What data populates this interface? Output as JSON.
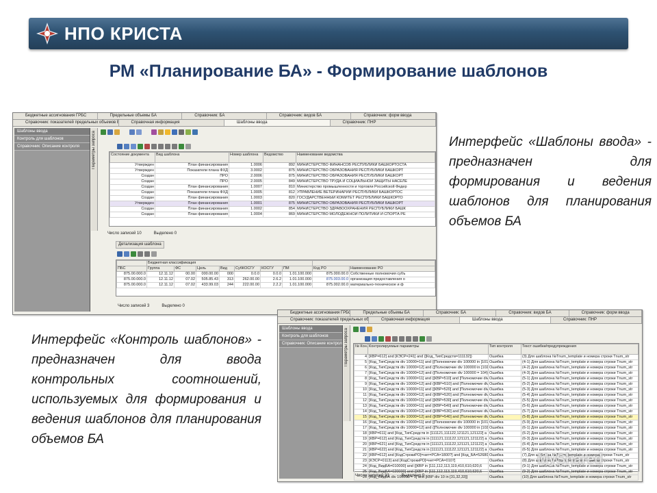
{
  "header": {
    "logo_text": "НПО КРИСТА"
  },
  "title": "РМ «Планирование БА» - Формирование шаблонов",
  "descriptions": [
    "Интерфейс «Шаблоны ввода» - предназначен для формирования и ведения шаблонов для планирования объемов БА",
    "Интерфейс «Контроль шаблонов» - предназначен для ввода контрольных соотношений, используемых для формирования и ведения шаблонов для планирования объемов БА"
  ],
  "window1": {
    "tabs_row1": [
      "Бюджетные ассигнования ГРБС",
      "Предельные объемы БА",
      "Справочник: БА",
      "Справочник: видов БА",
      "Справочник: форм ввода"
    ],
    "tabs_row2": [
      "Справочник: показателей предельных объемов БА",
      "Справочная информация",
      "Шаблоны ввода",
      "Справочник: ПНР"
    ],
    "sidebar": [
      "Шаблоны ввода",
      "Контроль для шаблонов",
      "Справочник: Описание контроля"
    ],
    "vertical_tab": "Параметры запроса",
    "columns": [
      "Состояние документа",
      "Вид шаблона",
      "Номер шаблона",
      "Ведомство",
      "Наименование ведомства"
    ],
    "rows": [
      [
        "Утвержден",
        "План финансирования",
        "1.0006",
        "892",
        "МИНИСТЕРСТВО ФИНАНСОВ РЕСПУБЛИКИ БАШКОРТОСТА"
      ],
      [
        "Утвержден",
        "Показатели плана ФХД",
        "3.0002",
        "875",
        "МИНИСТЕРСТВО ОБРАЗОВАНИЯ РЕСПУБЛИКИ БАШКОРТ"
      ],
      [
        "Создан",
        "ПРО",
        "2.0006",
        "875",
        "МИНИСТЕРСТВО ОБРАЗОВАНИЯ РЕСПУБЛИКИ БАШКОРТ"
      ],
      [
        "Создан",
        "ПРО",
        "2.0005",
        "849",
        "МИНИСТЕРСТВО ТРУДА И СОЦИАЛЬНОЙ ЗАЩИТЫ НАСЕЛЕ"
      ],
      [
        "Создан",
        "План финансирования",
        "1.0007",
        "810",
        "Министерство промышленности и торговли Российской Федер"
      ],
      [
        "Создан",
        "Показатели плана ФХД",
        "1.0005",
        "812",
        "УПРАВЛЕНИЕ ВЕТЕРИНАРИИ РЕСПУБЛИКИ БАШКОРТОС"
      ],
      [
        "Создан",
        "План финансирования",
        "1.0003",
        "820",
        "ГОСУДАРСТВЕННЫЙ КОМИТЕТ РЕСПУБЛИКИ БАШКОРТО"
      ],
      [
        "Утвержден",
        "План финансирования",
        "1.0001",
        "875",
        "МИНИСТЕРСТВО ОБРАЗОВАНИЯ РЕСПУБЛИКИ БАШКОРТ"
      ],
      [
        "Создан",
        "План финансирования",
        "1.0002",
        "854",
        "МИНИСТЕРСТВО ЗДРАВООХРАНЕНИЯ РЕСПУБЛИКИ БАШК"
      ],
      [
        "Создан",
        "План финансирования",
        "1.0004",
        "869",
        "МИНИСТЕРСТВО МОЛОДЕЖНОЙ ПОЛИТИКИ И СПОРТА РЕ"
      ]
    ],
    "status1": {
      "label": "Число записей",
      "count": "10",
      "selected_label": "Выделено",
      "selected": "0"
    },
    "detail_title": "Детализация шаблона",
    "detail_columns": [
      "ПБС",
      "Группа",
      "ФС",
      "Цель",
      "Вид",
      "СубКОСГУ",
      "КОСГУ",
      "ПМ",
      "Код РО",
      "Наименование РО"
    ],
    "detail_group_header": "Бюджетная классификация",
    "detail_rows": [
      [
        "875.00.000.0",
        "12.11.12",
        "00.00",
        "000.00.00",
        "000",
        "0.0.0",
        "0.0.0",
        "1.01.100.000",
        "875.000.00.0",
        "Собственные полномочия субъ"
      ],
      [
        "875.00.000.0",
        "12.11.12",
        "07.02",
        "505.85.43",
        "313",
        "262.00.00",
        "2.6.2",
        "1.01.100.000",
        "875.003.00.0",
        "организация предоставления о"
      ],
      [
        "875.00.000.0",
        "12.11.12",
        "07.02",
        "433.99.03",
        "244",
        "222.00.00",
        "2.2.2",
        "1.01.100.000",
        "875.002.00.0",
        "материально-техническое и ф"
      ]
    ],
    "status2": {
      "label": "Число записей",
      "count": "3",
      "selected_label": "Выделено",
      "selected": "0"
    }
  },
  "window2": {
    "tabs_row1": [
      "Бюджетные ассигнования ГРБС",
      "Предельные объемы БА",
      "Справочник: БА",
      "Справочник: видов БА",
      "Справочник: форм ввода"
    ],
    "tabs_row2": [
      "Справочник: показателей предельных объемов БА",
      "Справочная информация",
      "Шаблоны ввода",
      "Справочник: ПНР"
    ],
    "sidebar": [
      "Шаблоны ввода",
      "Контроль для шаблонов",
      "Справочник: Описание контроля"
    ],
    "vertical_tab": "Параметры запроса",
    "columns": [
      "№ Кон...",
      "Контролируемые параметры",
      "Тип контроля",
      "Текст ошибки/предупреждения"
    ],
    "rows": [
      [
        "4",
        "[КВР=612] and [КЭСР=241] and ([Код_ТипСредств=111132])",
        "Ошибка",
        "(3) Для шаблона №Tnum_template и номера строки Tnum_str"
      ],
      [
        "5",
        "[Код_ТипСредств div 10000=11] and ([Полномочие div 100000 in [101.1",
        "Ошибка",
        "(4-1) Для шаблона №Tnum_template и номера строки Tnum_str"
      ],
      [
        "6",
        "[Код_ТипСредств div 10000=12] and ([Полномочие div 100000 in [102.1",
        "Ошибка",
        "(4-2) Для шаблона №Tnum_template и номера строки Tnum_str"
      ],
      [
        "7",
        "[Код_ТипСредств div 10000=12] and ([Полномочие div 100000 = 104)",
        "Ошибка",
        "(4-3) Для шаблона №Tnum_template и номера строки Tnum_str"
      ],
      [
        "8",
        "[Код_ТипСредств div 10000=11] and ([КВР=510] and [Полномочие div 1",
        "Ошибка",
        "(5-1) Для шаблона №Tnum_template и номера строки Tnum_str"
      ],
      [
        "9",
        "[Код_ТипСредств div 10000=12] and ([КВР=510] and [Полномочие div 1",
        "Ошибка",
        "(5-2) Для шаблона №Tnum_template и номера строки Tnum_str"
      ],
      [
        "10",
        "[Код_ТипСредств div 10000=11] and ([КВР=520] and [Полномочие div 1",
        "Ошибка",
        "(5-3) Для шаблона №Tnum_template и номера строки Tnum_str"
      ],
      [
        "11",
        "[Код_ТипСредств div 10000=12] and ([КВР=520] and [Полномочие div 1",
        "Ошибка",
        "(5-4) Для шаблона №Tnum_template и номера строки Tnum_str"
      ],
      [
        "12",
        "[Код_ТипСредств div 10000=11] and ([КВР=530] and [Полномочие div 1",
        "Ошибка",
        "(5-5) Для шаблона №Tnum_template и номера строки Tnum_str"
      ],
      [
        "13",
        "[Код_ТипСредств div 10000=11] and ([КВР=540] and [Полномочие div 1",
        "Ошибка",
        "(5-6) Для шаблона №Tnum_template и номера строки Tnum_str"
      ],
      [
        "14",
        "[Код_ТипСредств div 10000=12] and ([КВР=530] and [Полномочие div 1",
        "Ошибка",
        "(5-7) Для шаблона №Tnum_template и номера строки Tnum_str"
      ],
      [
        "15",
        "[Код_ТипСредств div 10000=12] and ([КВР=540] and [Полномочие div 100000 = 103",
        "Ошибка",
        "(5-8) Для шаблона №Tnum_template и номера строки Tnum_str"
      ],
      [
        "16",
        "[Код_ТипСредств div 10000=11] and ([Полномочие div 100000 in [101.1",
        "Ошибка",
        "(5-9) Для шаблона №Tnum_template и номера строки Tnum_str"
      ],
      [
        "17",
        "[Код_ТипСредств div 10000=12] and ([Полномочие div 100000 in [102.1",
        "Ошибка",
        "(6-1) Для шаблона №Tnum_template и номера строки Tnum_str"
      ],
      [
        "18",
        "[КВР=611] and [Код_ТипСредств in [111121,111122,121121,121122] a",
        "Ошибка",
        "(6-2) Для шаблона №Tnum_template и номера строки Tnum_str"
      ],
      [
        "19",
        "[КВР=612] and [Код_ТипСредств in [111121,111122,121121,121122] a",
        "Ошибка",
        "(6-3) Для шаблона №Tnum_template и номера строки Tnum_str"
      ],
      [
        "20",
        "[КВР=621] and [Код_ТипСредств in [111121,111122,121121,121122] a",
        "Ошибка",
        "(6-4) Для шаблона №Tnum_template и номера строки Tnum_str"
      ],
      [
        "21",
        "[КВР=622] and [Код_ТипСредств in [111121,111122,121121,121122] a",
        "Ошибка",
        "(6-5) Для шаблона №Tnum_template и номера строки Tnum_str"
      ],
      [
        "22",
        "[КВР=612] and [КодСтрокиРО]=нет=РСА=1800?] and [Код_БА=526800",
        "Ошибка",
        "(7) Для шаблона №Tnum_template и номера строки Tnum_str"
      ],
      [
        "23",
        "[КЭСР=0113] and [КодСтрокиРО]=нет=РСА=0107]",
        "Ошибка",
        "(8) Для шаблона №Tnum_template и номера строки Tnum_str"
      ],
      [
        "24",
        "[Код_ВидБА=010000] and ([КВР in [111,112,113,119,410,610,620,6",
        "Ошибка",
        "(9-1) Для шаблона №Tnum_template и номера строки Tnum_str"
      ],
      [
        "25",
        "[Код_ВидБА=020000] and ([КВР in [111,112,113,119,410,610,620,6",
        "Ошибка",
        "(9-2) Для шаблона №Tnum_template и номера строки Tnum_str"
      ],
      [
        "26",
        "[Код_ВидБА div 100000 = 1] and [КВР div 10 in [31,32,33]]",
        "Ошибка",
        "(10) Для шаблона №Tnum_template и номера строки Tnum_str"
      ]
    ],
    "status": {
      "label": "Число записей",
      "count": "33",
      "selected_label": "Выделено",
      "selected": "0"
    }
  },
  "watermark": "MyShared",
  "colors": {
    "title": "#203a66",
    "banner": "#2e5272",
    "highlight_text": "#2a4ba0"
  }
}
